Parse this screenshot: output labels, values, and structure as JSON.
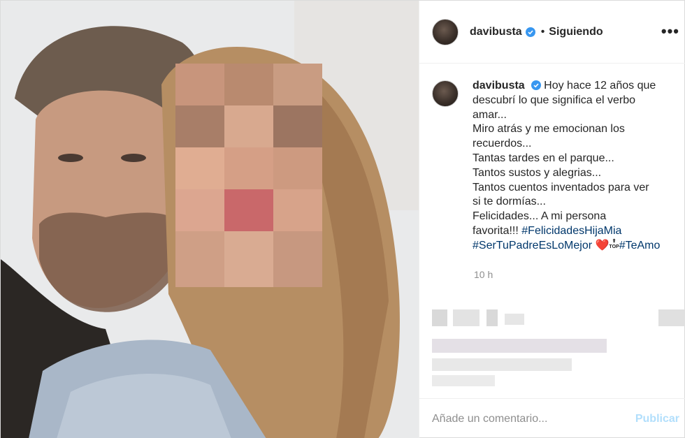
{
  "post": {
    "username": "davibusta",
    "follow_status": "Siguiendo",
    "separator": "•",
    "more_icon": "more-horizontal-icon",
    "verified_color": "#3897f0",
    "caption_lines": [
      "Hoy hace 12 años que",
      "descubrí lo que significa el verbo",
      "amar...",
      "Miro atrás y me emocionan los",
      "recuerdos...",
      "Tantas tardes en el parque...",
      "Tantos sustos y alegrias...",
      "Tantos cuentos inventados para ver",
      "si te dormías...",
      "Felicidades... A mi persona"
    ],
    "caption_line10_prefix": "favorita!!!",
    "hashtag_1": "#FelicidadesHijaMia",
    "hashtag_2": "#SerTuPadreEsLoMejor",
    "heart_emoji": "❤️",
    "top_icon_arrow": "⬆",
    "top_icon_text": "TOP",
    "hashtag_3": "#TeAmo",
    "time_ago": "10 h"
  },
  "comment_bar": {
    "placeholder": "Añade un comentario...",
    "publish_label": "Publicar",
    "publish_color": "#b2dffc"
  },
  "colors": {
    "hashtag": "#00376b",
    "muted": "#8e8e8e",
    "text": "#262626"
  }
}
